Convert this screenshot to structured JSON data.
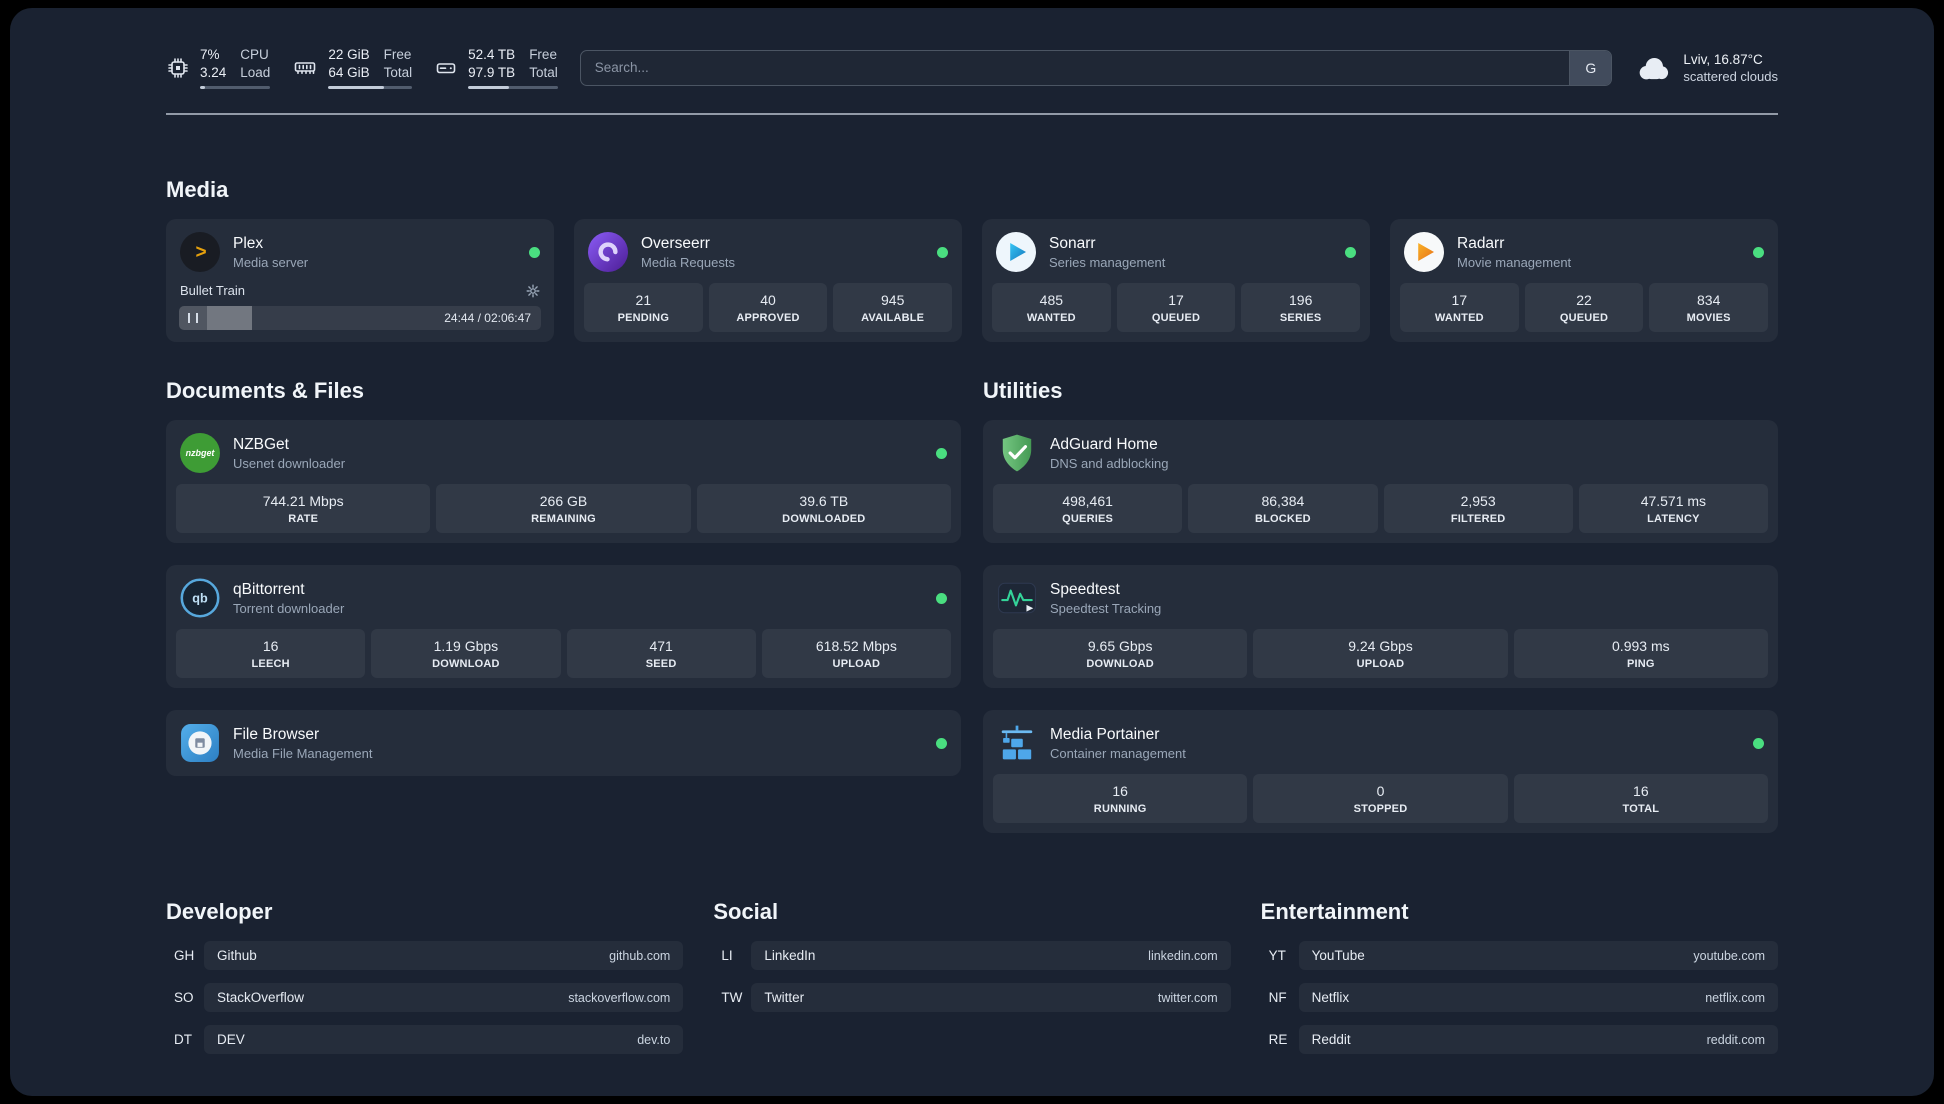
{
  "topbar": {
    "cpu": {
      "percent": "7%",
      "load": "3.24",
      "labels": [
        "CPU",
        "Load"
      ],
      "bar_percent": 7
    },
    "memory": {
      "free": "22 GiB",
      "total": "64 GiB",
      "labels": [
        "Free",
        "Total"
      ],
      "bar_percent": 66
    },
    "disk": {
      "free": "52.4 TB",
      "total": "97.9 TB",
      "labels": [
        "Free",
        "Total"
      ],
      "bar_percent": 46
    },
    "search": {
      "placeholder": "Search...",
      "provider_button": "G"
    },
    "weather": {
      "location": "Lviv, 16.87°C",
      "condition": "scattered clouds"
    }
  },
  "sections": {
    "media": {
      "title": "Media",
      "cards": [
        {
          "title": "Plex",
          "subtitle": "Media server",
          "status": "online",
          "player": {
            "track": "Bullet Train",
            "time": "24:44 / 02:06:47",
            "progress_percent": 20
          }
        },
        {
          "title": "Overseerr",
          "subtitle": "Media Requests",
          "status": "online",
          "stats": [
            {
              "value": "21",
              "label": "PENDING"
            },
            {
              "value": "40",
              "label": "APPROVED"
            },
            {
              "value": "945",
              "label": "AVAILABLE"
            }
          ]
        },
        {
          "title": "Sonarr",
          "subtitle": "Series management",
          "status": "online",
          "stats": [
            {
              "value": "485",
              "label": "WANTED"
            },
            {
              "value": "17",
              "label": "QUEUED"
            },
            {
              "value": "196",
              "label": "SERIES"
            }
          ]
        },
        {
          "title": "Radarr",
          "subtitle": "Movie management",
          "status": "online",
          "stats": [
            {
              "value": "17",
              "label": "WANTED"
            },
            {
              "value": "22",
              "label": "QUEUED"
            },
            {
              "value": "834",
              "label": "MOVIES"
            }
          ]
        }
      ]
    },
    "documents": {
      "title": "Documents & Files",
      "cards": [
        {
          "title": "NZBGet",
          "subtitle": "Usenet downloader",
          "status": "online",
          "stats": [
            {
              "value": "744.21 Mbps",
              "label": "RATE"
            },
            {
              "value": "266 GB",
              "label": "REMAINING"
            },
            {
              "value": "39.6 TB",
              "label": "DOWNLOADED"
            }
          ]
        },
        {
          "title": "qBittorrent",
          "subtitle": "Torrent downloader",
          "status": "online",
          "stats": [
            {
              "value": "16",
              "label": "LEECH"
            },
            {
              "value": "1.19 Gbps",
              "label": "DOWNLOAD"
            },
            {
              "value": "471",
              "label": "SEED"
            },
            {
              "value": "618.52 Mbps",
              "label": "UPLOAD"
            }
          ]
        },
        {
          "title": "File Browser",
          "subtitle": "Media File Management",
          "status": "online",
          "stats": []
        }
      ]
    },
    "utilities": {
      "title": "Utilities",
      "cards": [
        {
          "title": "AdGuard Home",
          "subtitle": "DNS and adblocking",
          "stats": [
            {
              "value": "498,461",
              "label": "QUERIES"
            },
            {
              "value": "86,384",
              "label": "BLOCKED"
            },
            {
              "value": "2,953",
              "label": "FILTERED"
            },
            {
              "value": "47.571 ms",
              "label": "LATENCY"
            }
          ]
        },
        {
          "title": "Speedtest",
          "subtitle": "Speedtest Tracking",
          "stats": [
            {
              "value": "9.65 Gbps",
              "label": "DOWNLOAD"
            },
            {
              "value": "9.24 Gbps",
              "label": "UPLOAD"
            },
            {
              "value": "0.993 ms",
              "label": "PING"
            }
          ]
        },
        {
          "title": "Media Portainer",
          "subtitle": "Container management",
          "status": "online",
          "stats": [
            {
              "value": "16",
              "label": "RUNNING"
            },
            {
              "value": "0",
              "label": "STOPPED"
            },
            {
              "value": "16",
              "label": "TOTAL"
            }
          ]
        }
      ]
    }
  },
  "bookmarks": {
    "developer": {
      "title": "Developer",
      "items": [
        {
          "abbr": "GH",
          "name": "Github",
          "domain": "github.com"
        },
        {
          "abbr": "SO",
          "name": "StackOverflow",
          "domain": "stackoverflow.com"
        },
        {
          "abbr": "DT",
          "name": "DEV",
          "domain": "dev.to"
        }
      ]
    },
    "social": {
      "title": "Social",
      "items": [
        {
          "abbr": "LI",
          "name": "LinkedIn",
          "domain": "linkedin.com"
        },
        {
          "abbr": "TW",
          "name": "Twitter",
          "domain": "twitter.com"
        }
      ]
    },
    "entertainment": {
      "title": "Entertainment",
      "items": [
        {
          "abbr": "YT",
          "name": "YouTube",
          "domain": "youtube.com"
        },
        {
          "abbr": "NF",
          "name": "Netflix",
          "domain": "netflix.com"
        },
        {
          "abbr": "RE",
          "name": "Reddit",
          "domain": "reddit.com"
        }
      ]
    }
  },
  "colors": {
    "status_online": "#4ade80",
    "plex_gold": "#e5a00d",
    "overseerr_purple": "#7c3aed",
    "sonarr_blue": "#2193d1",
    "radarr_orange": "#f0851f",
    "nzbget_green": "#3e9c35",
    "qbittorrent_blue": "#57a8dd",
    "filebrowser_blue": "#4da6e8",
    "adguard_green": "#5aab66",
    "speedtest_green": "#34d399",
    "portainer_blue": "#4ea7ea"
  }
}
